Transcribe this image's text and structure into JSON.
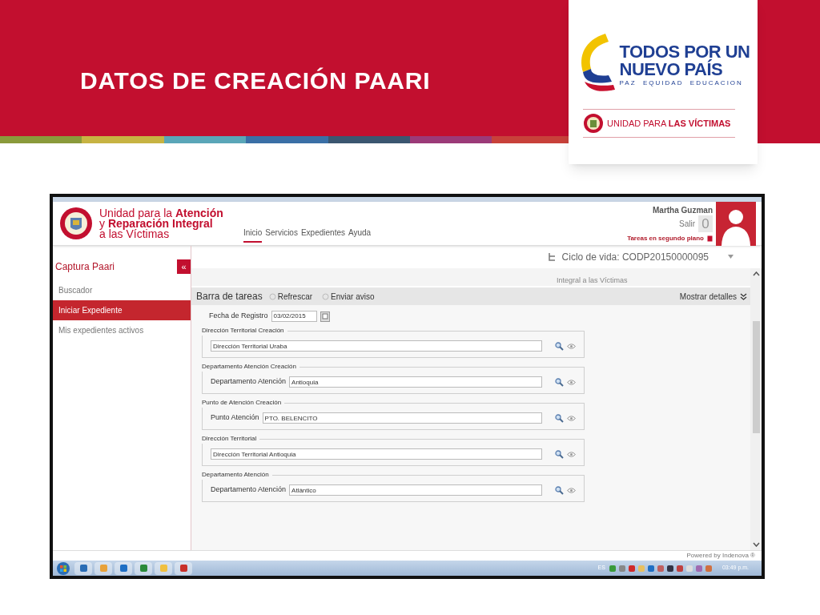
{
  "slide": {
    "title": "DATOS DE CREACIÓN PAARI"
  },
  "brand_card": {
    "slogan_lines": [
      "TODOS POR UN",
      "NUEVO PAÍS"
    ],
    "tagline": "PAZ  EQUIDAD  EDUCACION",
    "unit_name": "UNIDAD PARA **LAS VÍCTIMAS**"
  },
  "app": {
    "logo_lines": [
      "Unidad para la **Atención**",
      "y **Reparación Integral**",
      "a las Víctimas"
    ],
    "nav": [
      {
        "label": "Inicio",
        "selected": true
      },
      {
        "label": "Servicios",
        "selected": false
      },
      {
        "label": "Expedientes",
        "selected": false
      },
      {
        "label": "Ayuda",
        "selected": false
      }
    ],
    "user": {
      "name": "Martha Guzman",
      "logout": "Salir",
      "counter": "0",
      "background_tasks": "Tareas en segundo plano"
    },
    "sidebar": {
      "title": "Captura Paari",
      "collapse": "«",
      "items": [
        {
          "label": "Buscador",
          "selected": false
        },
        {
          "label": "Iniciar Expediente",
          "selected": true
        },
        {
          "label": "Mis expedientes activos",
          "selected": false
        }
      ]
    },
    "lifecycle": "Ciclo de vida: CODP20150000095",
    "behind_text": "Integral a las Víctimas",
    "toolbar": {
      "title": "Barra de tareas",
      "actions": [
        "Refrescar",
        "Enviar aviso"
      ],
      "details": "Mostrar detalles"
    },
    "form": {
      "date_label": "Fecha de Registro",
      "date_value": "03/02/2015",
      "groups": [
        {
          "legend": "Dirección Territorial Creación",
          "value": "Dirección Territorial Uraba"
        },
        {
          "legend": "Departamento Atención Creación",
          "label": "Departamento Atención",
          "value": "Antioquia"
        },
        {
          "legend": "Punto de Atención Creación",
          "label": "Punto Atención",
          "value": "PTO. BELENCITO"
        },
        {
          "legend": "Dirección Territorial",
          "value": "Dirección Territorial Antioquia"
        },
        {
          "legend": "Departamento Atención",
          "label": "Departamento Atención",
          "value": "Atlántico"
        }
      ]
    },
    "footer": "Powered by Indenova ®",
    "taskbar": {
      "language": "ES",
      "time": "03:49 p.m."
    }
  }
}
